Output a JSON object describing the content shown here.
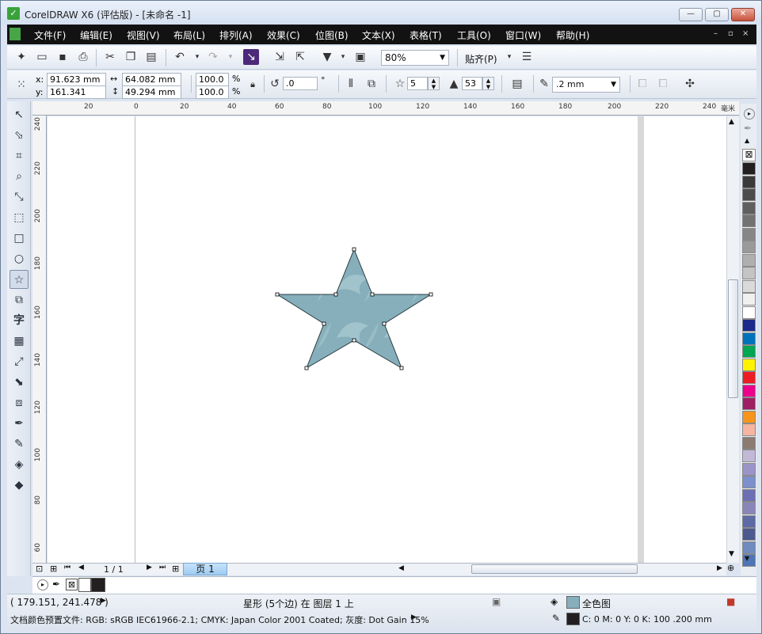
{
  "window": {
    "title": "CorelDRAW X6 (评估版) - [未命名 -1]",
    "controls": {
      "minimize": "—",
      "restore": "▢",
      "close": "✕"
    }
  },
  "menu": {
    "items": [
      "文件(F)",
      "编辑(E)",
      "视图(V)",
      "布局(L)",
      "排列(A)",
      "效果(C)",
      "位图(B)",
      "文本(X)",
      "表格(T)",
      "工具(O)",
      "窗口(W)",
      "帮助(H)"
    ],
    "doc_controls": {
      "min": "–",
      "restore": "▫",
      "close": "×"
    }
  },
  "standard_toolbar": {
    "zoom": "80%",
    "snap": "贴齐(P)"
  },
  "property_bar": {
    "x_label": "x:",
    "x": "91.623 mm",
    "y_label": "y:",
    "y": "161.341 mm",
    "width": "64.082 mm",
    "height": "49.294 mm",
    "scale_x": "100.0",
    "scale_y": "100.0",
    "percent": "%",
    "rotation": ".0",
    "degree": "°",
    "points": "5",
    "sharpness": "53",
    "outline": ".2 mm"
  },
  "ruler": {
    "unit": "毫米",
    "h_ticks": [
      "20",
      "0",
      "20",
      "40",
      "60",
      "80",
      "100",
      "120",
      "140",
      "160",
      "180",
      "200",
      "220",
      "240"
    ],
    "v_ticks": [
      "240",
      "220",
      "200",
      "180",
      "160",
      "140",
      "120",
      "100",
      "80",
      "60"
    ]
  },
  "page_nav": {
    "counter": "1 / 1",
    "tab": "页 1"
  },
  "status": {
    "coords": "( 179.151, 241.478 )",
    "object_info": "星形 (5个边) 在 图层 1 上",
    "color_profile": "文档颜色预置文件: RGB: sRGB IEC61966-2.1; CMYK: Japan Color 2001 Coated; 灰度: Dot Gain 15%",
    "fill_label": "全色图",
    "outline_info": "C: 0 M: 0 Y: 0 K: 100  .200 mm"
  },
  "palette_colors": [
    "#231f20",
    "#3a3a3a",
    "#4d4d4d",
    "#5f5f5f",
    "#727272",
    "#868686",
    "#9a9a9a",
    "#afafaf",
    "#c4c4c4",
    "#dadada",
    "#f0f0f0",
    "#ffffff",
    "#1b2a8a",
    "#0072bc",
    "#00a651",
    "#fff200",
    "#ed1c24",
    "#ec008c",
    "#9e1f63",
    "#f7941d",
    "#f5b5a0",
    "#8c7b70",
    "#c2b9d7",
    "#9b94c8",
    "#7b90cc",
    "#6c6fb4",
    "#8a85b9",
    "#5c6ba6",
    "#4d5a8f",
    "#6f8bc0",
    "#4f75b5"
  ],
  "colors": {
    "star_fill": "#86afbb",
    "star_stroke": "#2a3a40"
  }
}
